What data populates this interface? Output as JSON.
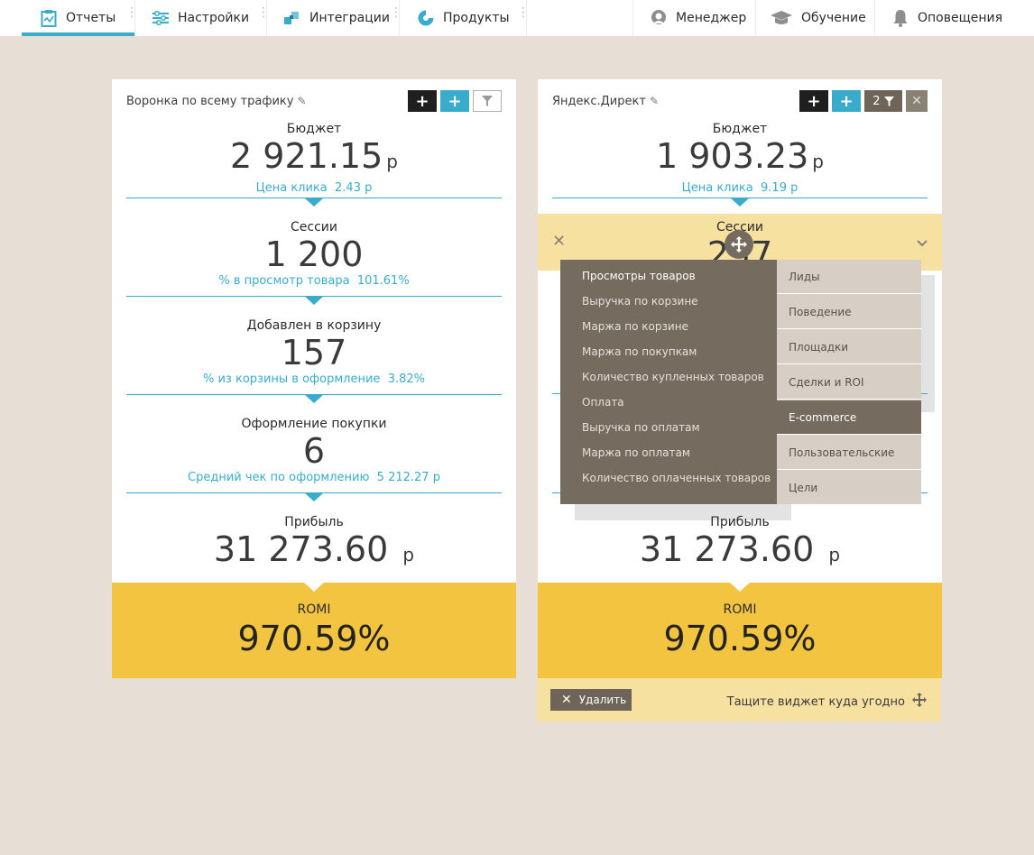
{
  "nav": {
    "left": [
      {
        "label": "Отчеты",
        "icon": "reports-icon"
      },
      {
        "label": "Настройки",
        "icon": "settings-icon"
      },
      {
        "label": "Интеграции",
        "icon": "integrations-icon"
      },
      {
        "label": "Продукты",
        "icon": "products-icon"
      }
    ],
    "right": [
      {
        "label": "Менеджер",
        "icon": "manager-icon"
      },
      {
        "label": "Обучение",
        "icon": "graduation-cap-icon"
      },
      {
        "label": "Оповещения",
        "icon": "bell-icon"
      }
    ],
    "accent": "#3aaccb"
  },
  "widget1": {
    "title": "Воронка по всему трафику",
    "stages": [
      {
        "label": "Бюджет",
        "value": "2 921.15",
        "unit": "р",
        "sub_label": "Цена клика",
        "sub_value": "2.43 р"
      },
      {
        "label": "Сессии",
        "value": "1 200",
        "unit": "",
        "sub_label": "% в просмотр товара",
        "sub_value": "101.61%"
      },
      {
        "label": "Добавлен в корзину",
        "value": "157",
        "unit": "",
        "sub_label": "% из корзины в оформление",
        "sub_value": "3.82%"
      },
      {
        "label": "Оформление покупки",
        "value": "6",
        "unit": "",
        "sub_label": "Средний чек по оформлению",
        "sub_value": "5 212.27 р"
      },
      {
        "label": "Прибыль",
        "value": "31 273.60",
        "unit": "р"
      }
    ],
    "romi_label": "ROMI",
    "romi_value": "970.59%"
  },
  "widget2": {
    "title": "Яндекс.Директ",
    "filter_count": "2",
    "budget": {
      "label": "Бюджет",
      "value": "1 903.23",
      "unit": "р",
      "sub_label": "Цена клика",
      "sub_value": "9.19 р"
    },
    "sessions": {
      "label": "Сессии",
      "value": "257"
    },
    "profit": {
      "label": "Прибыль",
      "value": "31 273.60",
      "unit": "р"
    },
    "romi_label": "ROMI",
    "romi_value": "970.59%",
    "delete_label": "Удалить",
    "drag_hint": "Тащите виджет куда угодно"
  },
  "dropdown": {
    "items": [
      "Просмотры товаров",
      "Выручка по корзине",
      "Маржа по корзине",
      "Маржа по покупкам",
      "Количество купленных товаров",
      "Оплата",
      "Выручка по оплатам",
      "Маржа по оплатам",
      "Количество оплаченных товаров"
    ],
    "categories": [
      "Лиды",
      "Поведение",
      "Площадки",
      "Сделки и ROI",
      "E-commerce",
      "Пользовательские",
      "Цели"
    ],
    "active_category": "E-commerce"
  }
}
